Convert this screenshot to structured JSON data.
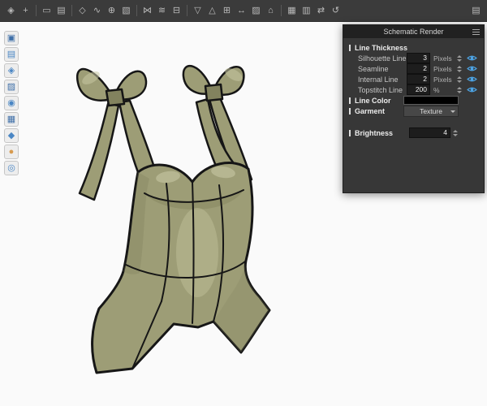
{
  "app": {
    "background": "#3b3b3b"
  },
  "top_toolbar": {
    "icons": [
      {
        "name": "gizmo-tool",
        "glyph": "◈"
      },
      {
        "name": "move-tool",
        "glyph": "+"
      },
      {
        "sep": true
      },
      {
        "name": "rectangle-select-tool",
        "glyph": "▭"
      },
      {
        "name": "pattern-select-tool",
        "glyph": "▤"
      },
      {
        "sep": true
      },
      {
        "name": "pen-tool",
        "glyph": "◇"
      },
      {
        "name": "edit-curve-tool",
        "glyph": "∿"
      },
      {
        "name": "add-point-tool",
        "glyph": "⊕"
      },
      {
        "name": "trace-tool",
        "glyph": "▧"
      },
      {
        "sep": true
      },
      {
        "name": "segment-sewing-tool",
        "glyph": "⋈"
      },
      {
        "name": "free-sewing-tool",
        "glyph": "≋"
      },
      {
        "name": "detach-sewing-tool",
        "glyph": "⊟"
      },
      {
        "sep": true
      },
      {
        "name": "dart-tool",
        "glyph": "▽"
      },
      {
        "name": "notch-tool",
        "glyph": "△"
      },
      {
        "name": "grading-tool",
        "glyph": "⊞"
      },
      {
        "name": "measure-tool",
        "glyph": "↔"
      },
      {
        "name": "fabric-texture-tool",
        "glyph": "▨"
      },
      {
        "name": "print-layout-tool",
        "glyph": "⌂"
      },
      {
        "sep": true
      },
      {
        "name": "show-grid-toggle",
        "glyph": "▦"
      },
      {
        "name": "show-pattern-toggle",
        "glyph": "▥"
      },
      {
        "name": "sync-view-toggle",
        "glyph": "⇄"
      },
      {
        "name": "reset-view",
        "glyph": "↺"
      },
      {
        "spacer": true
      },
      {
        "name": "toolbar-options",
        "glyph": "▤"
      }
    ]
  },
  "left_toolbar": {
    "icons": [
      {
        "name": "show-3d-garment",
        "glyph": "▣",
        "color": "#3f6fa8"
      },
      {
        "name": "show-2d-pattern",
        "glyph": "▤",
        "color": "#4a86c4"
      },
      {
        "name": "show-seamlines",
        "glyph": "◈",
        "color": "#4a86c4"
      },
      {
        "name": "show-internal-lines",
        "glyph": "▨",
        "color": "#3f6fa8"
      },
      {
        "name": "paint-texture",
        "glyph": "◉",
        "color": "#4a86c4"
      },
      {
        "name": "fabric-layers",
        "glyph": "▦",
        "color": "#3f6fa8"
      },
      {
        "name": "pin-garment",
        "glyph": "◆",
        "color": "#4a86c4"
      },
      {
        "name": "show-avatar",
        "glyph": "●",
        "color": "#d79a4f"
      },
      {
        "name": "render-view",
        "glyph": "◎",
        "color": "#4a86c4"
      }
    ]
  },
  "viewport": {
    "colors": {
      "bg": "#fafafa",
      "base": "#9d9d76",
      "shadow": "#82825e",
      "highlight": "#c7c7a3",
      "outline": "#161616"
    }
  },
  "panel": {
    "title": "Schematic Render",
    "accent_blue": "#4da6e8",
    "line_thickness": {
      "label": "Line Thickness",
      "rows": [
        {
          "label": "Silhouette Line",
          "value": "3",
          "unit": "Pixels"
        },
        {
          "label": "Seamline",
          "value": "2",
          "unit": "Pixels"
        },
        {
          "label": "Internal Line",
          "value": "2",
          "unit": "Pixels"
        },
        {
          "label": "Topstitch Line",
          "value": "200",
          "unit": "%"
        }
      ]
    },
    "line_color": {
      "label": "Line Color",
      "color": "#000000"
    },
    "garment": {
      "label": "Garment",
      "value": "Texture"
    },
    "brightness": {
      "label": "Brightness",
      "value": "4"
    }
  }
}
